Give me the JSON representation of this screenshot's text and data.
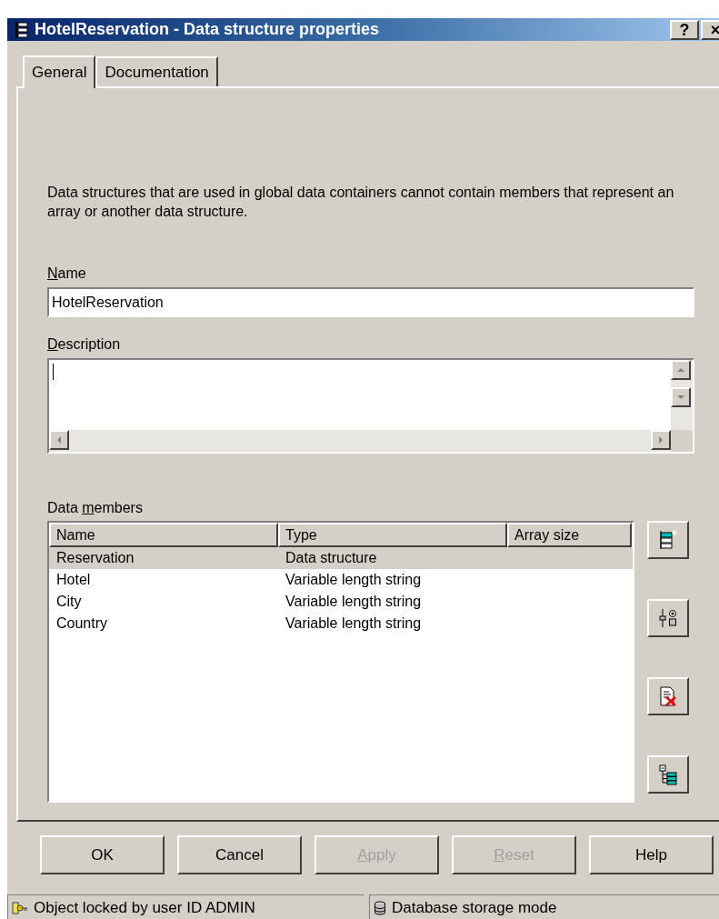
{
  "window": {
    "title": "HotelReservation - Data structure properties",
    "controls": [
      "?",
      "×"
    ]
  },
  "tabs": [
    {
      "label": "General",
      "selected": true
    },
    {
      "label": "Documentation",
      "selected": false
    }
  ],
  "info_text": "Data structures that are used in global data containers cannot contain members that represent an array or another data structure.",
  "name_field": {
    "access_key": "N",
    "label_after": "ame",
    "value": "HotelReservation"
  },
  "description_field": {
    "access_key": "D",
    "label_after": "escription"
  },
  "data_members": {
    "label_before": "Data ",
    "access_key": "m",
    "label_after": "embers",
    "columns": [
      "Name",
      "Type",
      "Array size"
    ],
    "rows": [
      {
        "cells": [
          "Reservation",
          "Data structure"
        ],
        "selected": true
      },
      {
        "cells": [
          "Hotel",
          "Variable length string"
        ],
        "selected": false
      },
      {
        "cells": [
          "City",
          "Variable length string"
        ],
        "selected": false
      },
      {
        "cells": [
          "Country",
          "Variable length string"
        ],
        "selected": false
      }
    ],
    "side_buttons": [
      {
        "kind": "add"
      },
      {
        "kind": "properties"
      },
      {
        "kind": "delete"
      },
      {
        "kind": "tree"
      }
    ]
  },
  "buttons": [
    {
      "label_after": "OK",
      "disabled": false
    },
    {
      "label_after": "Cancel",
      "disabled": false
    },
    {
      "access_key": "A",
      "label_after": "pply",
      "disabled": true
    },
    {
      "access_key": "R",
      "label_after": "eset",
      "disabled": true
    },
    {
      "label_after": "Help",
      "disabled": false
    }
  ],
  "status_bar": [
    {
      "kind": "lock",
      "text": "Object locked by user ID ADMIN"
    },
    {
      "kind": "database",
      "text": "Database storage mode"
    }
  ]
}
